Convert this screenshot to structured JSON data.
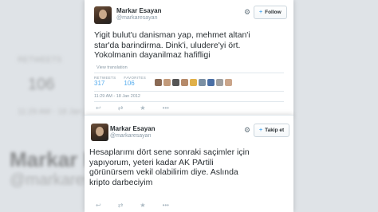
{
  "background": {
    "name": "Markar Esayan",
    "handle": "@markaresayan",
    "stat_label": "RETWEETS",
    "stat_value": "106",
    "date": "11:29 AM - 18 Jan 2012"
  },
  "tweet1": {
    "name": "Markar Esayan",
    "handle": "@markaresayan",
    "follow_label": "Follow",
    "text": "Yigit bulut'u danisman yap, mehmet altan'i\nstar'da barindirma. Dink'i, uludere'yi ört.\nYokolmanin dayanilmaz hafifligi",
    "translate": "View translation",
    "retweets_label": "RETWEETS",
    "retweets": "317",
    "favorites_label": "FAVORITES",
    "favorites": "106",
    "timestamp": "11:29 AM - 18 Jan 2012",
    "face_colors": [
      "#8a6a55",
      "#c29a7a",
      "#555555",
      "#b58a6a",
      "#e0b04a",
      "#7a8fa3",
      "#4a6fa5",
      "#a0a0a0",
      "#caa58a"
    ]
  },
  "tweet2": {
    "name": "Markar Esayan",
    "handle": "@markaresayan",
    "follow_label": "Takip et",
    "text": "Hesaplarımı dört sene sonraki saçimler için\nyapıyorum, yeteri kadar AK PArtili\ngörünürsem vekil olabilirim diye. Aslında\nkripto darbeciyim"
  },
  "icons": {
    "gear": "⚙",
    "plus_user": "+",
    "reply": "↩",
    "retweet": "⇄",
    "favorite": "★",
    "more": "•••"
  }
}
